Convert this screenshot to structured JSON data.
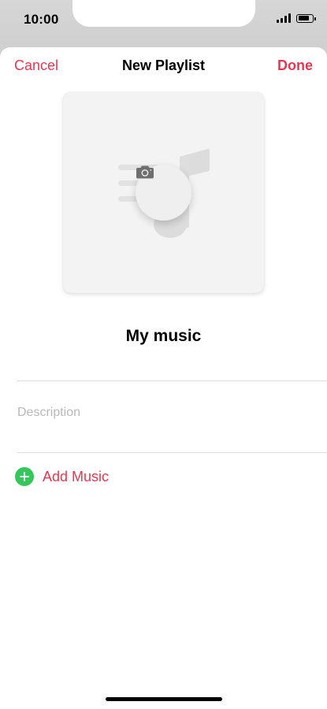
{
  "status_bar": {
    "time": "10:00",
    "signal_icon": "cellular-signal-icon",
    "battery_icon": "battery-icon",
    "battery_level": 0.85
  },
  "nav": {
    "cancel_label": "Cancel",
    "title": "New Playlist",
    "done_label": "Done"
  },
  "artwork": {
    "placeholder_icon": "music-note-icon",
    "camera_icon": "camera-icon"
  },
  "playlist": {
    "name": "My music",
    "description_placeholder": "Description"
  },
  "actions": {
    "add_music_label": "Add Music",
    "add_icon": "plus-circle-icon"
  },
  "colors": {
    "accent": "#e8364f",
    "add_green": "#34c759",
    "placeholder_gray": "#b8b8b8"
  }
}
